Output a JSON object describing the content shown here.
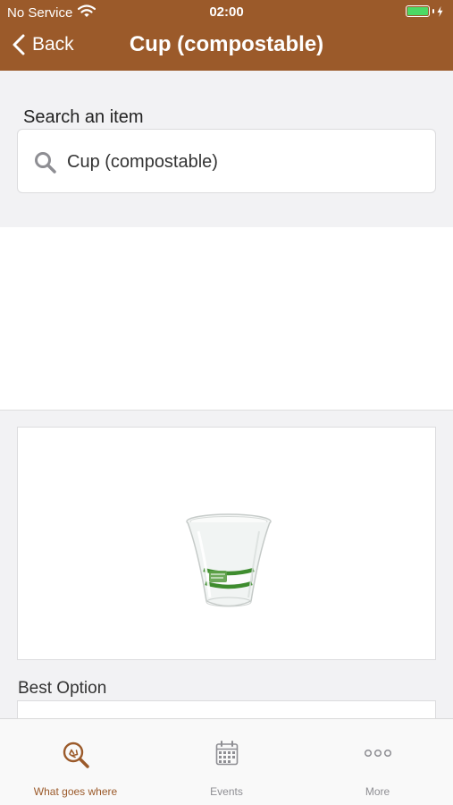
{
  "status_bar": {
    "carrier": "No Service",
    "time": "02:00",
    "battery_color": "#4cd964"
  },
  "nav": {
    "back_label": "Back",
    "title": "Cup (compostable)",
    "background_color": "#9b5a2a"
  },
  "search": {
    "label": "Search an item",
    "value": "Cup (compostable)",
    "icon": "search-icon"
  },
  "item": {
    "image_icon": "compostable-cup-image",
    "best_option_label": "Best Option"
  },
  "tab_bar": {
    "tabs": [
      {
        "label": "What goes where",
        "icon": "recycle-search-icon",
        "active": true
      },
      {
        "label": "Events",
        "icon": "calendar-icon",
        "active": false
      },
      {
        "label": "More",
        "icon": "more-icon",
        "active": false
      }
    ],
    "active_color": "#9b5a2a",
    "inactive_color": "#8e8e93"
  }
}
